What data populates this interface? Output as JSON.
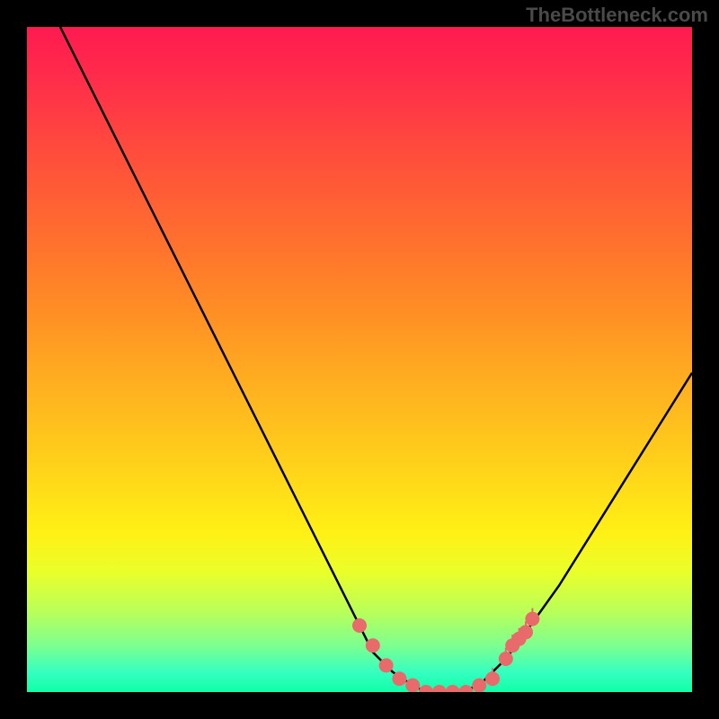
{
  "watermark": "TheBottleneck.com",
  "chart_data": {
    "type": "line",
    "title": "",
    "xlabel": "",
    "ylabel": "",
    "xlim": [
      0,
      100
    ],
    "ylim": [
      0,
      100
    ],
    "series": [
      {
        "name": "curve",
        "x": [
          5,
          10,
          15,
          20,
          25,
          30,
          35,
          40,
          45,
          50,
          52,
          55,
          58,
          60,
          62,
          65,
          68,
          70,
          72,
          75,
          80,
          85,
          90,
          95,
          100
        ],
        "values": [
          100,
          90,
          80,
          70,
          60,
          50,
          40,
          30,
          20,
          10,
          6,
          3,
          1,
          0,
          0,
          0,
          1,
          3,
          5,
          9,
          16,
          24,
          32,
          40,
          48
        ]
      }
    ],
    "markers": {
      "name": "red-dots",
      "color": "#e86a6a",
      "x": [
        50,
        52,
        54,
        56,
        58,
        60,
        62,
        64,
        66,
        68,
        70,
        72,
        73,
        74,
        75,
        76
      ],
      "values": [
        10,
        7,
        4,
        2,
        1,
        0,
        0,
        0,
        0,
        1,
        2,
        5,
        7,
        8,
        9,
        11
      ]
    },
    "background_gradient": {
      "top": "#ff1a50",
      "mid": "#ffd21a",
      "bottom": "#10ffa8"
    }
  }
}
